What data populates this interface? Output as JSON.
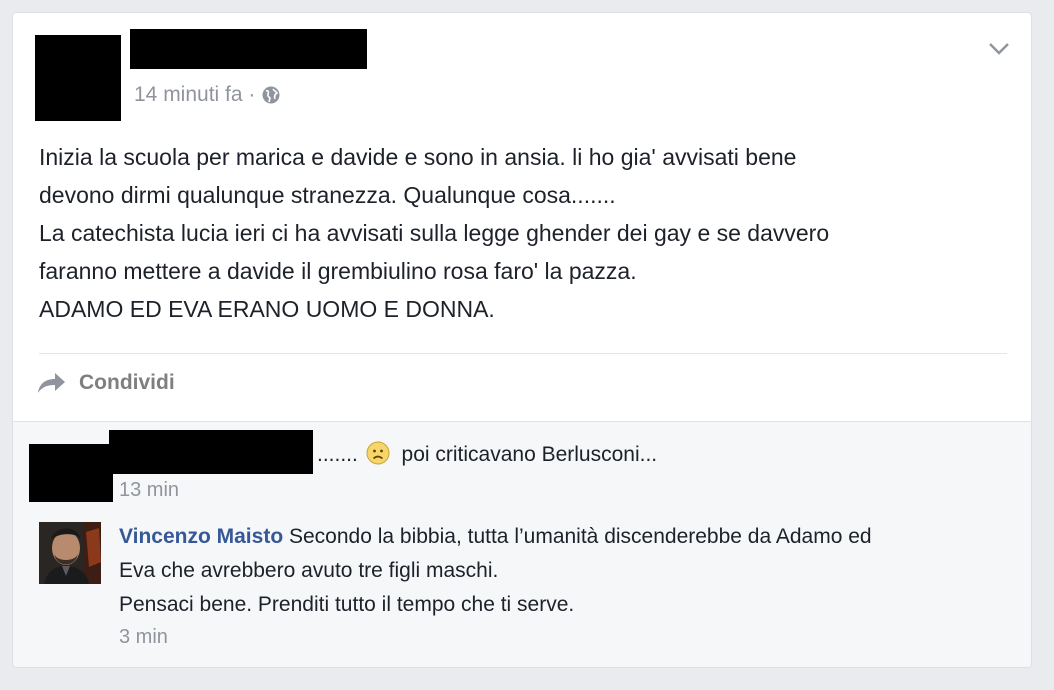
{
  "post": {
    "timestamp": "14 minuti fa ·",
    "text_lines": [
      "Inizia la scuola per marica e davide e sono in ansia. li ho gia' avvisati bene",
      "devono dirmi qualunque stranezza. Qualunque cosa.......",
      "La catechista lucia ieri ci ha avvisati sulla legge ghender dei gay e se davvero",
      "faranno mettere a davide il grembiulino rosa faro' la pazza.",
      "ADAMO ED EVA ERANO UOMO E DONNA."
    ],
    "share_label": "Condividi"
  },
  "comments": [
    {
      "text_before": "....... ",
      "emoji": "frown-emoji",
      "text_after": " poi criticavano Berlusconi...",
      "time": "13 min"
    },
    {
      "author": "Vincenzo Maisto",
      "lines": [
        " Secondo la bibbia, tutta l’umanità discenderebbe da Adamo ed",
        "Eva che avrebbero avuto tre figli maschi.",
        "Pensaci bene. Prenditi tutto il tempo che ti serve."
      ],
      "time": "3 min"
    }
  ],
  "colors": {
    "link": "#365899",
    "meta": "#90949c",
    "background": "#e9ebee"
  }
}
